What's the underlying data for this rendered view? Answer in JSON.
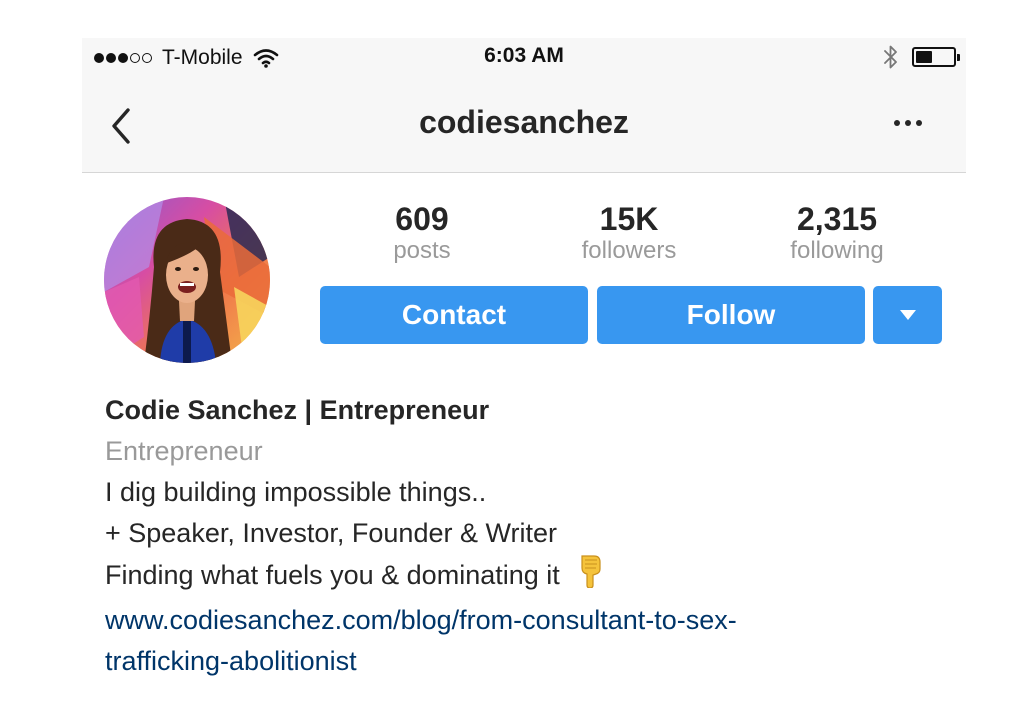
{
  "status_bar": {
    "carrier": "T-Mobile",
    "signal_bars_filled": 3,
    "signal_bars_total": 5,
    "time": "6:03 AM",
    "battery_level": 0.45
  },
  "nav": {
    "title": "codiesanchez",
    "back_icon": "chevron-left-icon",
    "more_icon": "ellipsis-icon"
  },
  "profile": {
    "stats": [
      {
        "value": "609",
        "label": "posts"
      },
      {
        "value": "15K",
        "label": "followers"
      },
      {
        "value": "2,315",
        "label": "following"
      }
    ],
    "buttons": {
      "contact": "Contact",
      "follow": "Follow",
      "dropdown_icon": "triangle-down-icon"
    }
  },
  "bio": {
    "name": "Codie Sanchez | Entrepreneur",
    "category": "Entrepreneur",
    "line1": "I dig building impossible things..",
    "line2": "+ Speaker, Investor, Founder & Writer",
    "line3": "Finding what fuels you & dominating it",
    "line3_emoji": "pointing-down-hand-icon",
    "link_line1": "www.codiesanchez.com/blog/from-consultant-to-sex-",
    "link_line2": "trafficking-abolitionist"
  },
  "colors": {
    "accent": "#3897f0",
    "link": "#003569",
    "muted": "#999999",
    "bar_bg": "#f7f7f7"
  }
}
